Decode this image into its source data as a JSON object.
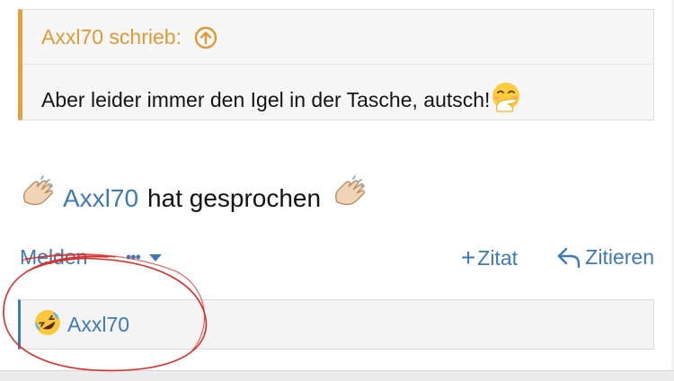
{
  "quote": {
    "author_label": "Axxl70 schrieb:",
    "text": "Aber leider immer den Igel in der Tasche, autsch!",
    "emoji": "face-with-hand-over-mouth"
  },
  "post": {
    "lead_emoji": "clapping-hands",
    "mention": "Axxl70",
    "text": "hat gesprochen",
    "trail_emoji": "clapping-hands"
  },
  "actions": {
    "report_label": "Melden",
    "more_label": "•••",
    "quote_add_label": "Zitat",
    "reply_label": "Zitieren"
  },
  "reactions": {
    "emoji": "rolling-on-floor-laughing",
    "user": "Axxl70"
  },
  "colors": {
    "link": "#3f7ab5",
    "quote_accent": "#e2a242",
    "annotation": "#d9302a"
  }
}
